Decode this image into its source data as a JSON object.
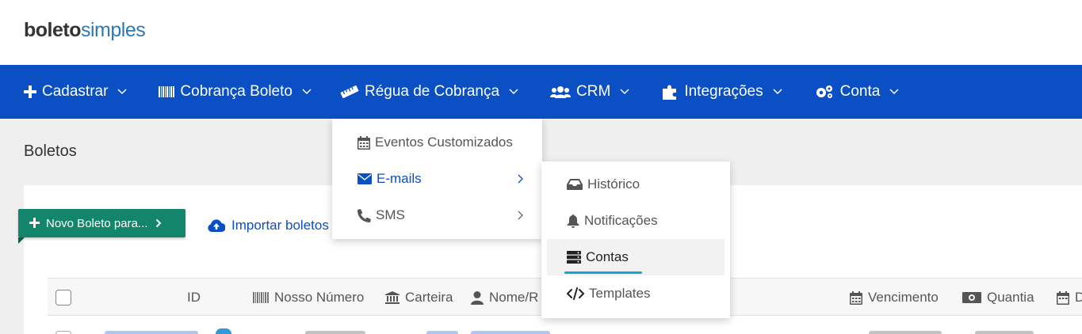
{
  "logo": {
    "bold": "boleto",
    "light": "simples"
  },
  "nav": {
    "items": [
      {
        "label": "Cadastrar",
        "icon": "plus-icon"
      },
      {
        "label": "Cobrança Boleto",
        "icon": "barcode-icon"
      },
      {
        "label": "Régua de Cobrança",
        "icon": "ruler-icon"
      },
      {
        "label": "CRM",
        "icon": "users-icon"
      },
      {
        "label": "Integrações",
        "icon": "puzzle-icon"
      },
      {
        "label": "Conta",
        "icon": "gears-icon"
      }
    ]
  },
  "page": {
    "title": "Boletos"
  },
  "actions": {
    "new_boleto": "Novo Boleto para...",
    "import": "Importar boletos"
  },
  "table": {
    "headers": {
      "id": "ID",
      "nosso_numero": "Nosso Número",
      "carteira": "Carteira",
      "nome": "Nome/R",
      "vencimento": "Vencimento",
      "quantia": "Quantia",
      "d": "D"
    }
  },
  "menu_regua": {
    "items": [
      {
        "label": "Eventos Customizados",
        "icon": "calendar-icon"
      },
      {
        "label": "E-mails",
        "icon": "envelope-icon"
      },
      {
        "label": "SMS",
        "icon": "phone-icon"
      }
    ]
  },
  "menu_emails": {
    "items": [
      {
        "label": "Histórico",
        "icon": "inbox-icon"
      },
      {
        "label": "Notificações",
        "icon": "bell-icon"
      },
      {
        "label": "Contas",
        "icon": "server-icon"
      },
      {
        "label": "Templates",
        "icon": "code-icon"
      }
    ]
  },
  "colors": {
    "nav_bg": "#0a4fc4",
    "accent_green": "#13856b",
    "link_blue": "#0a4fc4",
    "highlight": "#1aa3d6"
  }
}
